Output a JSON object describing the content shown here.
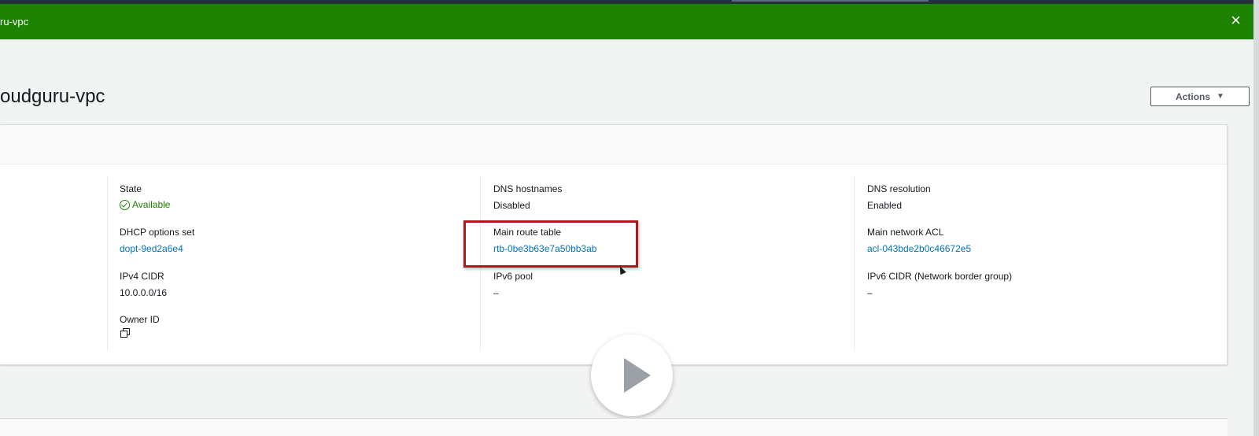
{
  "banner": {
    "text": "ru-vpc",
    "close_symbol": "×"
  },
  "page": {
    "title": "oudguru-vpc",
    "actions_label": "Actions",
    "actions_caret": "▼"
  },
  "details": {
    "col1": {
      "state_label": "State",
      "state_value": "Available",
      "dhcp_label": "DHCP options set",
      "dhcp_value": "dopt-9ed2a6e4",
      "ipv4_label": "IPv4 CIDR",
      "ipv4_value": "10.0.0.0/16",
      "owner_label": "Owner ID"
    },
    "col2": {
      "dns_hostnames_label": "DNS hostnames",
      "dns_hostnames_value": "Disabled",
      "main_route_table_label": "Main route table",
      "main_route_table_value": "rtb-0be3b63e7a50bb3ab",
      "ipv6_pool_label": "IPv6 pool",
      "ipv6_pool_value": "–"
    },
    "col3": {
      "dns_resolution_label": "DNS resolution",
      "dns_resolution_value": "Enabled",
      "main_network_acl_label": "Main network ACL",
      "main_network_acl_value": "acl-043bde2b0c46672e5",
      "ipv6_cidr_label": "IPv6 CIDR (Network border group)",
      "ipv6_cidr_value": "–"
    }
  },
  "colors": {
    "success_banner": "#1d8102",
    "link": "#0073bb",
    "highlight": "#b0181e"
  },
  "icons": [
    "close-icon",
    "caret-down-icon",
    "check-circle-icon",
    "copy-icon",
    "play-icon",
    "mouse-cursor-icon"
  ]
}
